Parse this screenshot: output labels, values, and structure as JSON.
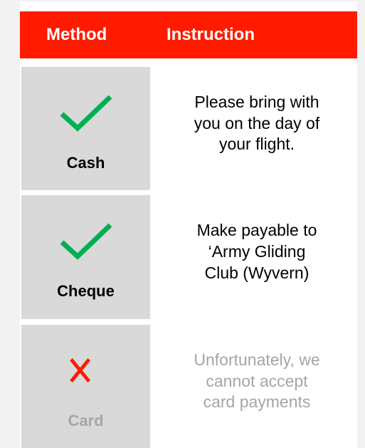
{
  "header": {
    "method_label": "Method",
    "instruction_label": "Instruction",
    "background_color": "#ff1a00"
  },
  "rows": [
    {
      "method": "Cash",
      "icon": "check-icon",
      "accepted": true,
      "instruction_lines": [
        "Please bring with",
        "you on the day of",
        "your flight."
      ]
    },
    {
      "method": "Cheque",
      "icon": "check-icon",
      "accepted": true,
      "instruction_lines": [
        "Make payable to",
        "‘Army Gliding",
        "Club (Wyvern)"
      ]
    },
    {
      "method": "Card",
      "icon": "cross-icon",
      "accepted": false,
      "instruction_lines": [
        "Unfortunately, we",
        "cannot accept",
        "card payments"
      ]
    }
  ],
  "colors": {
    "check": "#00b050",
    "cross": "#ff1a00",
    "disabled_text": "#a6a6a6",
    "method_cell_bg": "#d9d9d9"
  }
}
